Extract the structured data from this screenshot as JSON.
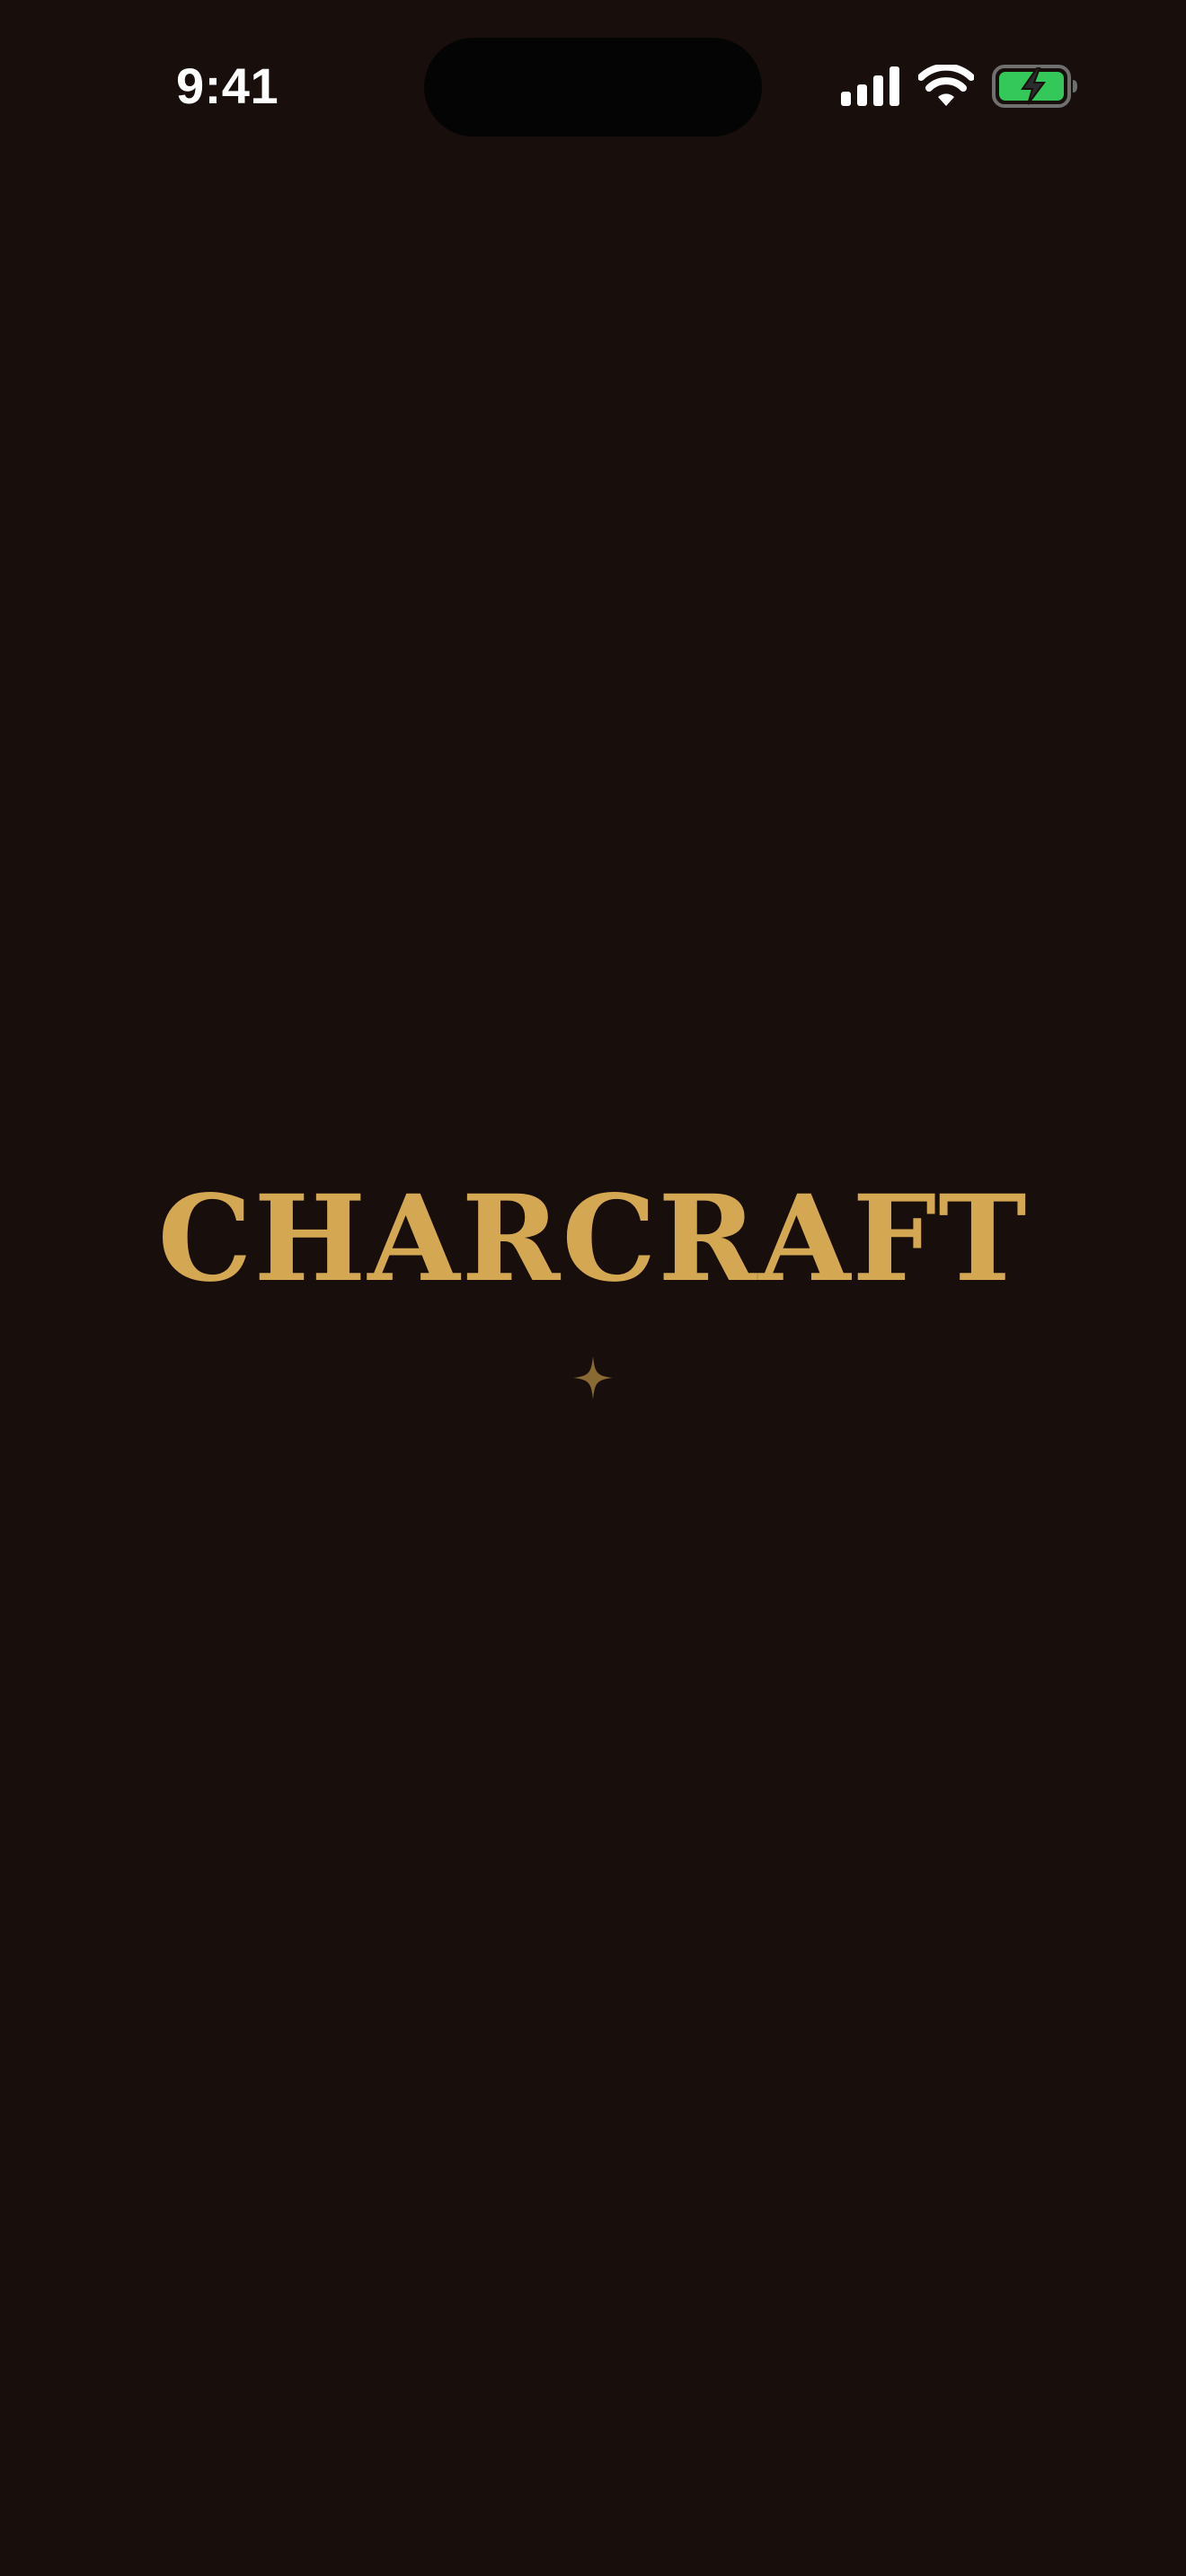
{
  "status_bar": {
    "time": "9:41",
    "signal_icon": "cellular-signal-icon",
    "wifi_icon": "wifi-icon",
    "battery_icon": "battery-charging-icon"
  },
  "splash": {
    "app_name": "CHARCRAFT",
    "ornament_icon": "sparkle-icon"
  },
  "colors": {
    "background": "#180e0b",
    "brand_gold": "#d4a853",
    "ornament": "#8a6a33",
    "battery_fill": "#34c759"
  }
}
